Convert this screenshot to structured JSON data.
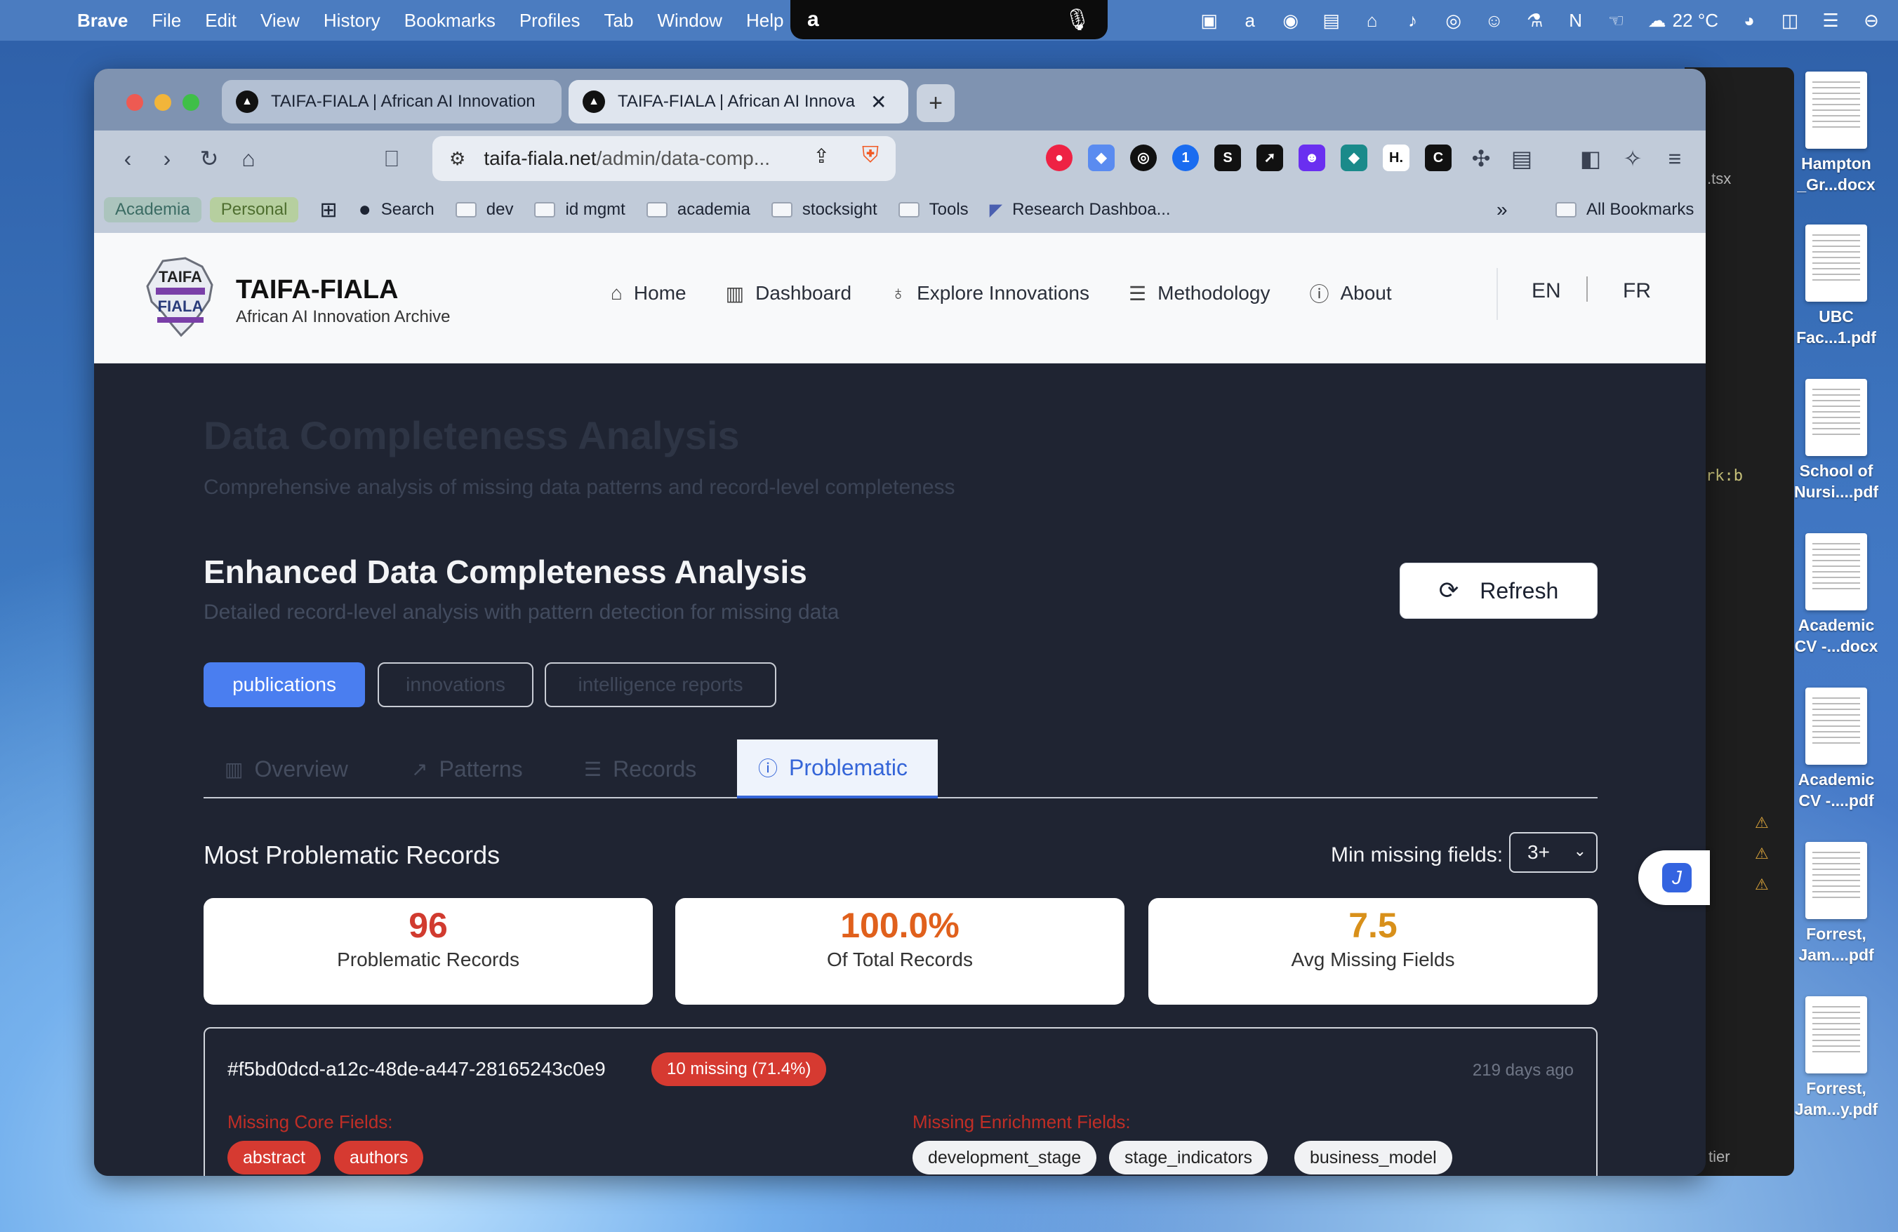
{
  "menubar": {
    "app": "Brave",
    "items": [
      "File",
      "Edit",
      "View",
      "History",
      "Bookmarks",
      "Profiles",
      "Tab",
      "Window",
      "Help"
    ],
    "weather": "22 °C"
  },
  "desktop_files": [
    {
      "name": "Hampton\n_Gr...docx"
    },
    {
      "name": "UBC\nFac...1.pdf"
    },
    {
      "name": "School of\nNursi....pdf"
    },
    {
      "name": "Academic\nCV -...docx"
    },
    {
      "name": "Academic\nCV -....pdf"
    },
    {
      "name": "Forrest,\nJam....pdf"
    },
    {
      "name": "Forrest,\nJam...y.pdf"
    }
  ],
  "editor": {
    "snippet1": ".tsx",
    "snippet2": "rk:b",
    "snippet3": "tier"
  },
  "browser": {
    "tabs": [
      {
        "title": "TAIFA-FIALA | African AI Innovation",
        "active": false
      },
      {
        "title": "TAIFA-FIALA | African AI Innova",
        "active": true
      }
    ],
    "url_domain": "taifa-fiala.net",
    "url_path": "/admin/data-comp...",
    "bookmarks": {
      "profile_chips": [
        "Academia",
        "Personal"
      ],
      "items": [
        "Search",
        "dev",
        "id mgmt",
        "academia",
        "stocksight",
        "Tools",
        "Research Dashboa..."
      ],
      "all": "All Bookmarks"
    }
  },
  "site": {
    "brand_title": "TAIFA-FIALA",
    "brand_subtitle": "African AI Innovation Archive",
    "logo_top": "TAIFA",
    "logo_bottom": "FIALA",
    "nav": [
      {
        "label": "Home",
        "icon": "home-icon"
      },
      {
        "label": "Dashboard",
        "icon": "bar-chart-icon"
      },
      {
        "label": "Explore Innovations",
        "icon": "lightbulb-icon"
      },
      {
        "label": "Methodology",
        "icon": "database-icon"
      },
      {
        "label": "About",
        "icon": "info-icon"
      }
    ],
    "lang": [
      "EN",
      "FR"
    ]
  },
  "page": {
    "title": "Data Completeness Analysis",
    "subtitle": "Comprehensive analysis of missing data patterns and record-level completeness",
    "section_title": "Enhanced Data Completeness Analysis",
    "section_subtitle": "Detailed record-level analysis with pattern detection for missing data",
    "refresh_label": "Refresh",
    "dataset_tabs": [
      "publications",
      "innovations",
      "intelligence reports"
    ],
    "view_tabs": [
      {
        "label": "Overview",
        "icon": "bar-chart-icon"
      },
      {
        "label": "Patterns",
        "icon": "trend-icon"
      },
      {
        "label": "Records",
        "icon": "database-icon"
      },
      {
        "label": "Problematic",
        "icon": "alert-circle-icon"
      }
    ],
    "problematic": {
      "heading": "Most Problematic Records",
      "min_label": "Min missing fields:",
      "min_value": "3+",
      "stats": [
        {
          "value": "96",
          "label": "Problematic Records",
          "color": "#d13b2f"
        },
        {
          "value": "100.0%",
          "label": "Of Total Records",
          "color": "#e0601c"
        },
        {
          "value": "7.5",
          "label": "Avg Missing Fields",
          "color": "#d8901a"
        }
      ],
      "record": {
        "id": "#f5bd0dcd-a12c-48de-a447-28165243c0e9",
        "badge": "10 missing (71.4%)",
        "age": "219 days ago",
        "core_label": "Missing Core Fields:",
        "core_fields": [
          "abstract",
          "authors"
        ],
        "enrich_label": "Missing Enrichment Fields:",
        "enrich_fields": [
          "development_stage",
          "stage_indicators",
          "business_model"
        ]
      }
    }
  }
}
